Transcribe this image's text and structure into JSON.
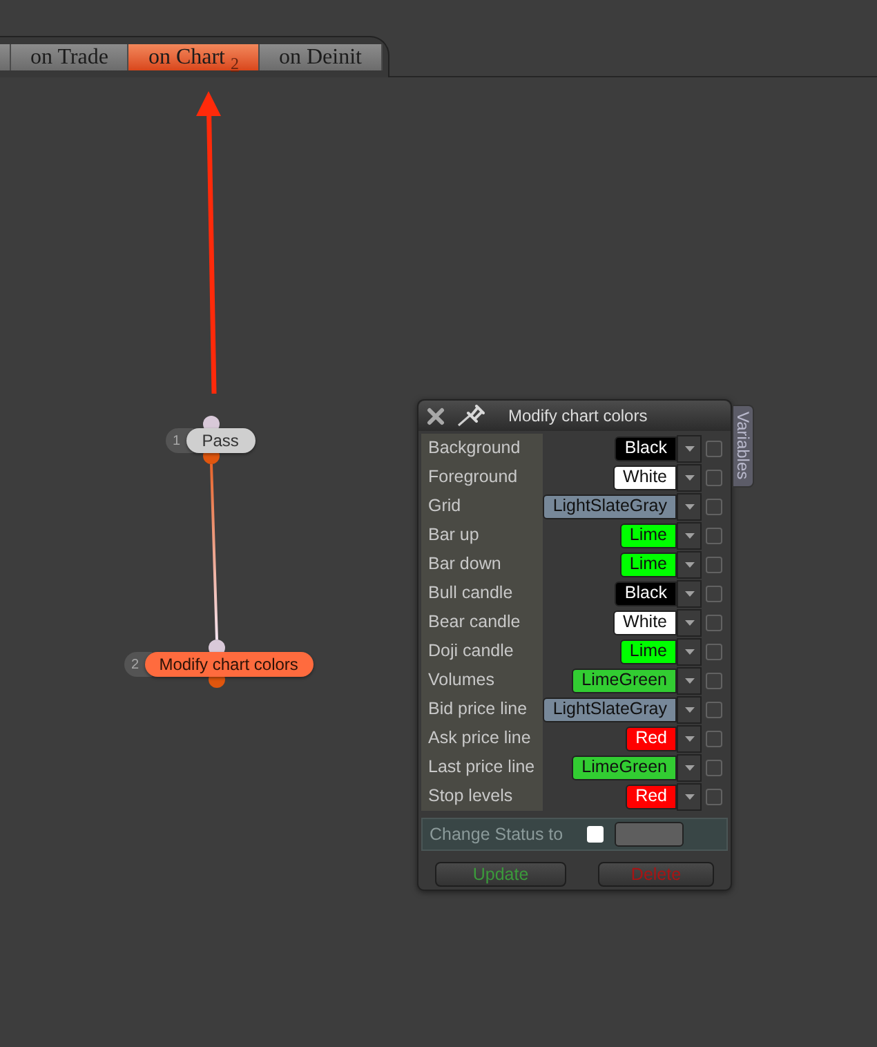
{
  "tabs": [
    {
      "selected": false
    },
    {
      "label": "on Trade",
      "selected": false
    },
    {
      "label": "on Chart",
      "count": "2",
      "selected": true
    },
    {
      "label": "on Deinit",
      "selected": false
    }
  ],
  "flow": {
    "nodes": [
      {
        "number": "1",
        "label": "Pass",
        "selected": false
      },
      {
        "number": "2",
        "label": "Modify chart colors",
        "selected": true
      }
    ]
  },
  "dialog": {
    "title": "Modify chart colors",
    "side_tab": "Variables",
    "properties": [
      {
        "label": "Background",
        "value": "Black",
        "color": "#000000",
        "checked": false
      },
      {
        "label": "Foreground",
        "value": "White",
        "color": "#ffffff",
        "checked": false
      },
      {
        "label": "Grid",
        "value": "LightSlateGray",
        "color": "#778899",
        "checked": false
      },
      {
        "label": "Bar up",
        "value": "Lime",
        "color": "#00ff00",
        "checked": false
      },
      {
        "label": "Bar down",
        "value": "Lime",
        "color": "#00ff00",
        "checked": false
      },
      {
        "label": "Bull candle",
        "value": "Black",
        "color": "#000000",
        "checked": false
      },
      {
        "label": "Bear candle",
        "value": "White",
        "color": "#ffffff",
        "checked": false
      },
      {
        "label": "Doji candle",
        "value": "Lime",
        "color": "#00ff00",
        "checked": false
      },
      {
        "label": "Volumes",
        "value": "LimeGreen",
        "color": "#32cd32",
        "checked": false
      },
      {
        "label": "Bid price line",
        "value": "LightSlateGray",
        "color": "#778899",
        "checked": false
      },
      {
        "label": "Ask price line",
        "value": "Red",
        "color": "#ff0000",
        "checked": false
      },
      {
        "label": "Last price line",
        "value": "LimeGreen",
        "color": "#32cd32",
        "checked": false
      },
      {
        "label": "Stop levels",
        "value": "Red",
        "color": "#ff0000",
        "checked": false
      }
    ],
    "status": {
      "label": "Change Status to",
      "checked": false
    },
    "buttons": [
      {
        "label": "Update",
        "kind": "update"
      },
      {
        "label": "Delete",
        "kind": "delete"
      }
    ]
  }
}
